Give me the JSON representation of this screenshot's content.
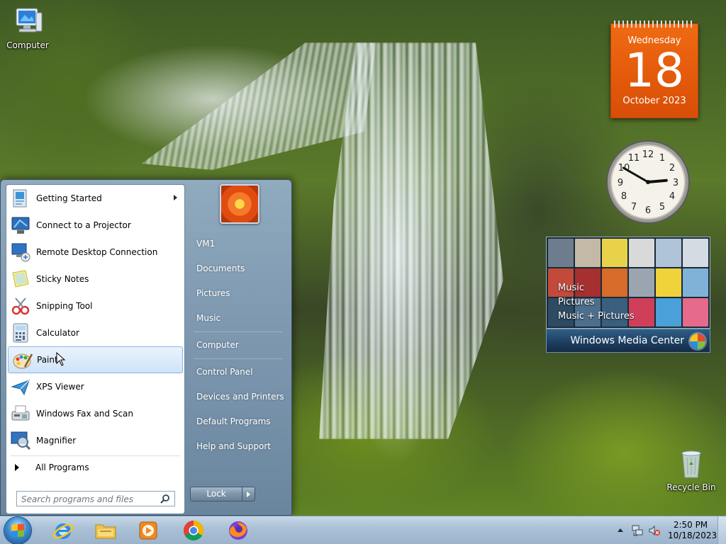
{
  "desktop": {
    "icons": [
      {
        "label": "Computer",
        "icon": "computer-icon"
      },
      {
        "label": "Recycle Bin",
        "icon": "recycle-bin-icon"
      }
    ]
  },
  "gadgets": {
    "calendar": {
      "weekday": "Wednesday",
      "day": "18",
      "month_year": "October 2023",
      "color": "#e85c0d"
    },
    "clock": {
      "hour": 2,
      "minute": 50
    },
    "media_center": {
      "labels": [
        "Music",
        "Pictures",
        "Music + Pictures"
      ],
      "brand": "Windows Media Center"
    }
  },
  "start_menu": {
    "programs": [
      {
        "label": "Getting Started",
        "icon": "getting-started-icon",
        "has_submenu": true
      },
      {
        "label": "Connect to a Projector",
        "icon": "projector-icon"
      },
      {
        "label": "Remote Desktop Connection",
        "icon": "remote-desktop-icon"
      },
      {
        "label": "Sticky Notes",
        "icon": "sticky-notes-icon"
      },
      {
        "label": "Snipping Tool",
        "icon": "snipping-tool-icon"
      },
      {
        "label": "Calculator",
        "icon": "calculator-icon"
      },
      {
        "label": "Paint",
        "icon": "paint-icon",
        "highlighted": true
      },
      {
        "label": "XPS Viewer",
        "icon": "xps-viewer-icon"
      },
      {
        "label": "Windows Fax and Scan",
        "icon": "fax-scan-icon"
      },
      {
        "label": "Magnifier",
        "icon": "magnifier-icon"
      }
    ],
    "all_programs": "All Programs",
    "search_placeholder": "Search programs and files",
    "right_links": [
      "VM1",
      "Documents",
      "Pictures",
      "Music",
      "Computer",
      "Control Panel",
      "Devices and Printers",
      "Default Programs",
      "Help and Support"
    ],
    "lock_label": "Lock"
  },
  "taskbar": {
    "apps": [
      "internet-explorer-icon",
      "file-explorer-icon",
      "media-player-icon",
      "chrome-icon",
      "firefox-icon"
    ],
    "time": "2:50 PM",
    "date": "10/18/2023",
    "accent": "#3c8ad0"
  }
}
